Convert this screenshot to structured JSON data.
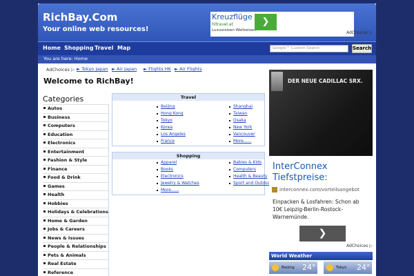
{
  "header": {
    "title": "RichBay.Com",
    "tagline": "Your online web resources!"
  },
  "top_ad": {
    "headline": "Kreuzflüge",
    "url": "hltravel.at",
    "description": "Luxusreisen Weltreisen",
    "adchoices": "AdChoices ▷"
  },
  "nav": {
    "items": [
      "Home",
      "Shopping",
      "Travel",
      "Map"
    ],
    "search_placeholder": "Google™ Custom Search",
    "search_button": "Search"
  },
  "breadcrumb": "You are here: Home",
  "ad_links": {
    "adchoices": "AdChoices ▷",
    "links": [
      "► Tokyo Japan",
      "► Air Japan",
      "► Flights HK",
      "► Air Flights"
    ]
  },
  "welcome": "Welcome to RichBay!",
  "categories": {
    "title": "Categories",
    "items": [
      "Autos",
      "Business",
      "Computers",
      "Education",
      "Electronics",
      "Entertainment",
      "Fashion & Style",
      "Finance",
      "Food & Drink",
      "Games",
      "Health",
      "Hobbies",
      "Holidays & Celebrations",
      "Home & Garden",
      "Jobs & Careers",
      "News & Issues",
      "People & Relationships",
      "Pets & Animals",
      "Real Estate",
      "Reference"
    ]
  },
  "travel": {
    "title": "Travel",
    "col1": [
      "Beijing",
      "Hong Kong",
      "Tokyo",
      "Korea",
      "Los Angeles",
      "France"
    ],
    "col2": [
      "Shanghai",
      "Taiwan",
      "Osaka",
      "New York",
      "Vancouver",
      "More......"
    ]
  },
  "shopping": {
    "title": "Shopping",
    "col1": [
      "Apparel",
      "Books",
      "Electronics",
      "Jewelry & Watches",
      "More......"
    ],
    "col2": [
      "Babies & Kids",
      "Computers",
      "Health & Beauty",
      "Sport and Outdoor"
    ]
  },
  "cadillac_ad": {
    "text": "DER NEUE CADILLAC SRX."
  },
  "interconnex_ad": {
    "headline": "InterConnex Tiefstpreise:",
    "url": "interconnex.com/vorteilsangebot",
    "body": "Einpacken & Losfahren: Schon ab 10€ Leipzig-Berlin-Rostock-Warnemünde.",
    "adchoices": "AdChoices ▷"
  },
  "weather": {
    "title": "World Weather",
    "items": [
      {
        "city": "Beijing",
        "temp": "24°"
      },
      {
        "city": "Tokyo",
        "temp": "24°"
      }
    ]
  },
  "colors": {
    "header_blue": "#3a62c4",
    "nav_blue": "#1e3c9e",
    "link_blue": "#1a3ec2",
    "body_bg": "#1d2d6b"
  }
}
